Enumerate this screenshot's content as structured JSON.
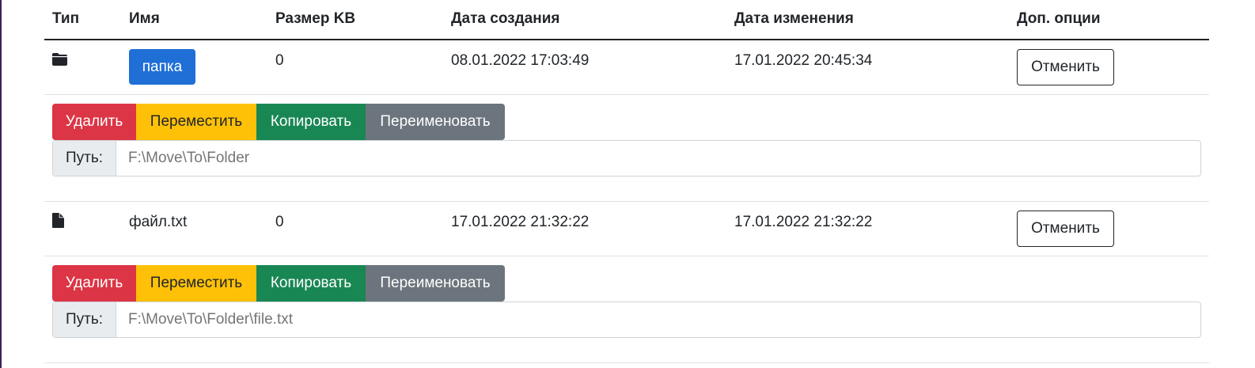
{
  "headers": {
    "type": "Тип",
    "name": "Имя",
    "size": "Размер KB",
    "created": "Дата создания",
    "modified": "Дата изменения",
    "options": "Доп. опции"
  },
  "rows": [
    {
      "kind": "folder",
      "icon": "folder-icon",
      "name": "папка",
      "size": "0",
      "created": "08.01.2022 17:03:49",
      "modified": "17.01.2022 20:45:34",
      "cancel_label": "Отменить",
      "actions": {
        "delete": "Удалить",
        "move": "Переместить",
        "copy": "Копировать",
        "rename": "Переименовать"
      },
      "path_label": "Путь:",
      "path_placeholder": "F:\\Move\\To\\Folder"
    },
    {
      "kind": "file",
      "icon": "file-icon",
      "name": "файл.txt",
      "size": "0",
      "created": "17.01.2022 21:32:22",
      "modified": "17.01.2022 21:32:22",
      "cancel_label": "Отменить",
      "actions": {
        "delete": "Удалить",
        "move": "Переместить",
        "copy": "Копировать",
        "rename": "Переименовать"
      },
      "path_label": "Путь:",
      "path_placeholder": "F:\\Move\\To\\Folder\\file.txt"
    }
  ],
  "colors": {
    "primary": "#1f6fd6",
    "danger": "#dc3545",
    "warning": "#ffc107",
    "success": "#198754",
    "secondary": "#6c757d"
  }
}
